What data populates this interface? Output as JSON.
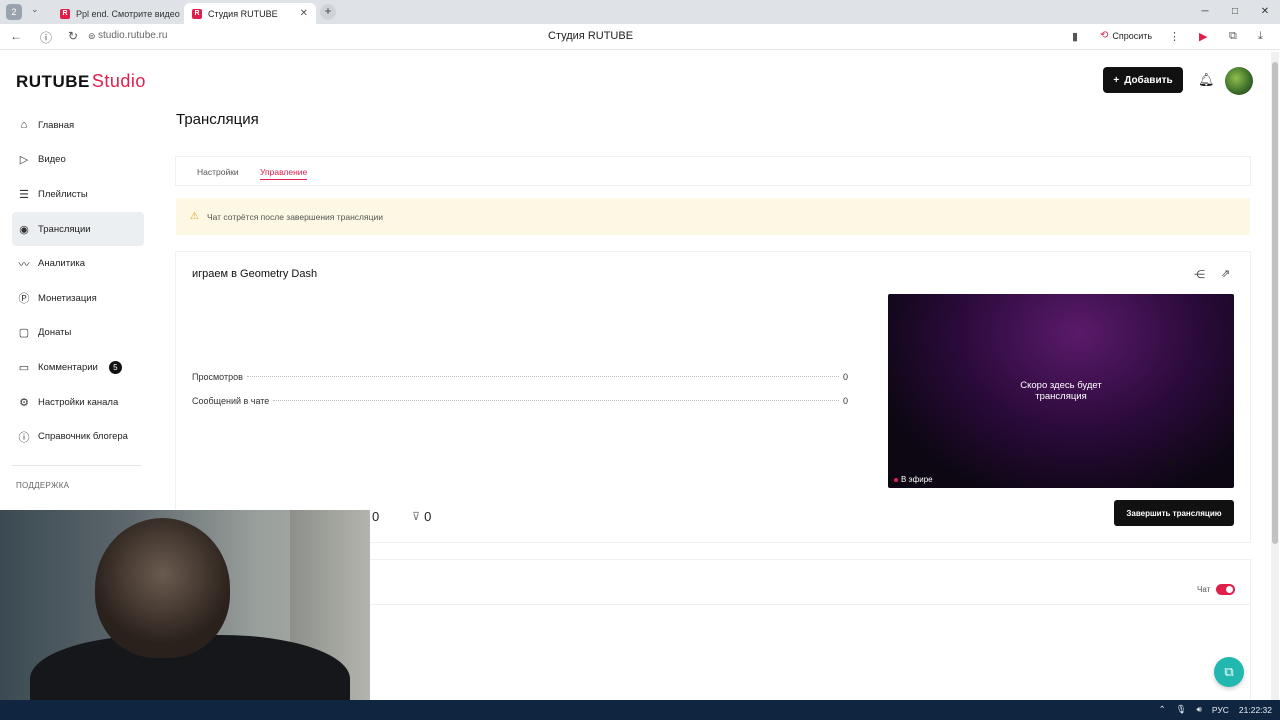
{
  "browser": {
    "profile_number": "2",
    "tabs": [
      {
        "label": "Ppl end. Смотрите видео",
        "active": false
      },
      {
        "label": "Студия RUTUBE",
        "active": true
      }
    ],
    "new_tab": "+",
    "url": "studio.rutube.ru",
    "page_title": "Студия RUTUBE",
    "ask_label": "Спросить",
    "window_controls": [
      "─",
      "□",
      "✕"
    ]
  },
  "header": {
    "logo_brand": "RUTUBE",
    "logo_suffix": "Studio",
    "add_button": "Добавить"
  },
  "sidebar": {
    "items": [
      {
        "label": "Главная",
        "icon": "home-icon",
        "active": false
      },
      {
        "label": "Видео",
        "icon": "video-icon",
        "active": false
      },
      {
        "label": "Плейлисты",
        "icon": "playlist-icon",
        "active": false
      },
      {
        "label": "Трансляции",
        "icon": "broadcast-icon",
        "active": true
      },
      {
        "label": "Аналитика",
        "icon": "analytics-icon",
        "active": false
      },
      {
        "label": "Монетизация",
        "icon": "monetization-icon",
        "active": false
      },
      {
        "label": "Донаты",
        "icon": "donate-icon",
        "active": false
      },
      {
        "label": "Комментарии",
        "icon": "comments-icon",
        "active": false,
        "badge": "5"
      },
      {
        "label": "Настройки канала",
        "icon": "settings-icon",
        "active": false
      },
      {
        "label": "Справочник блогера",
        "icon": "help-icon",
        "active": false
      }
    ],
    "support_label": "ПОДДЕРЖКА"
  },
  "main": {
    "title": "Трансляция",
    "tabs": [
      {
        "label": "Настройки",
        "active": false
      },
      {
        "label": "Управление",
        "active": true
      }
    ],
    "warning": "Чат сотрётся после завершения трансляции",
    "stream": {
      "title": "играем в Geometry Dash",
      "stats": [
        {
          "label": "Просмотров",
          "value": "0"
        },
        {
          "label": "Сообщений в чате",
          "value": "0"
        }
      ],
      "player_message_line1": "Скоро здесь будет",
      "player_message_line2": "трансляция",
      "live_label": "В эфире",
      "likes": "0",
      "dislikes": "0",
      "end_button": "Завершить трансляцию"
    },
    "chat": {
      "toggle_label": "Чат",
      "enabled": true
    }
  },
  "taskbar": {
    "lang": "РУС",
    "time": "21:22:32"
  },
  "colors": {
    "accent": "#e0204a",
    "warning_bg": "#fdf8e3",
    "help_fab": "#22b8b0"
  }
}
